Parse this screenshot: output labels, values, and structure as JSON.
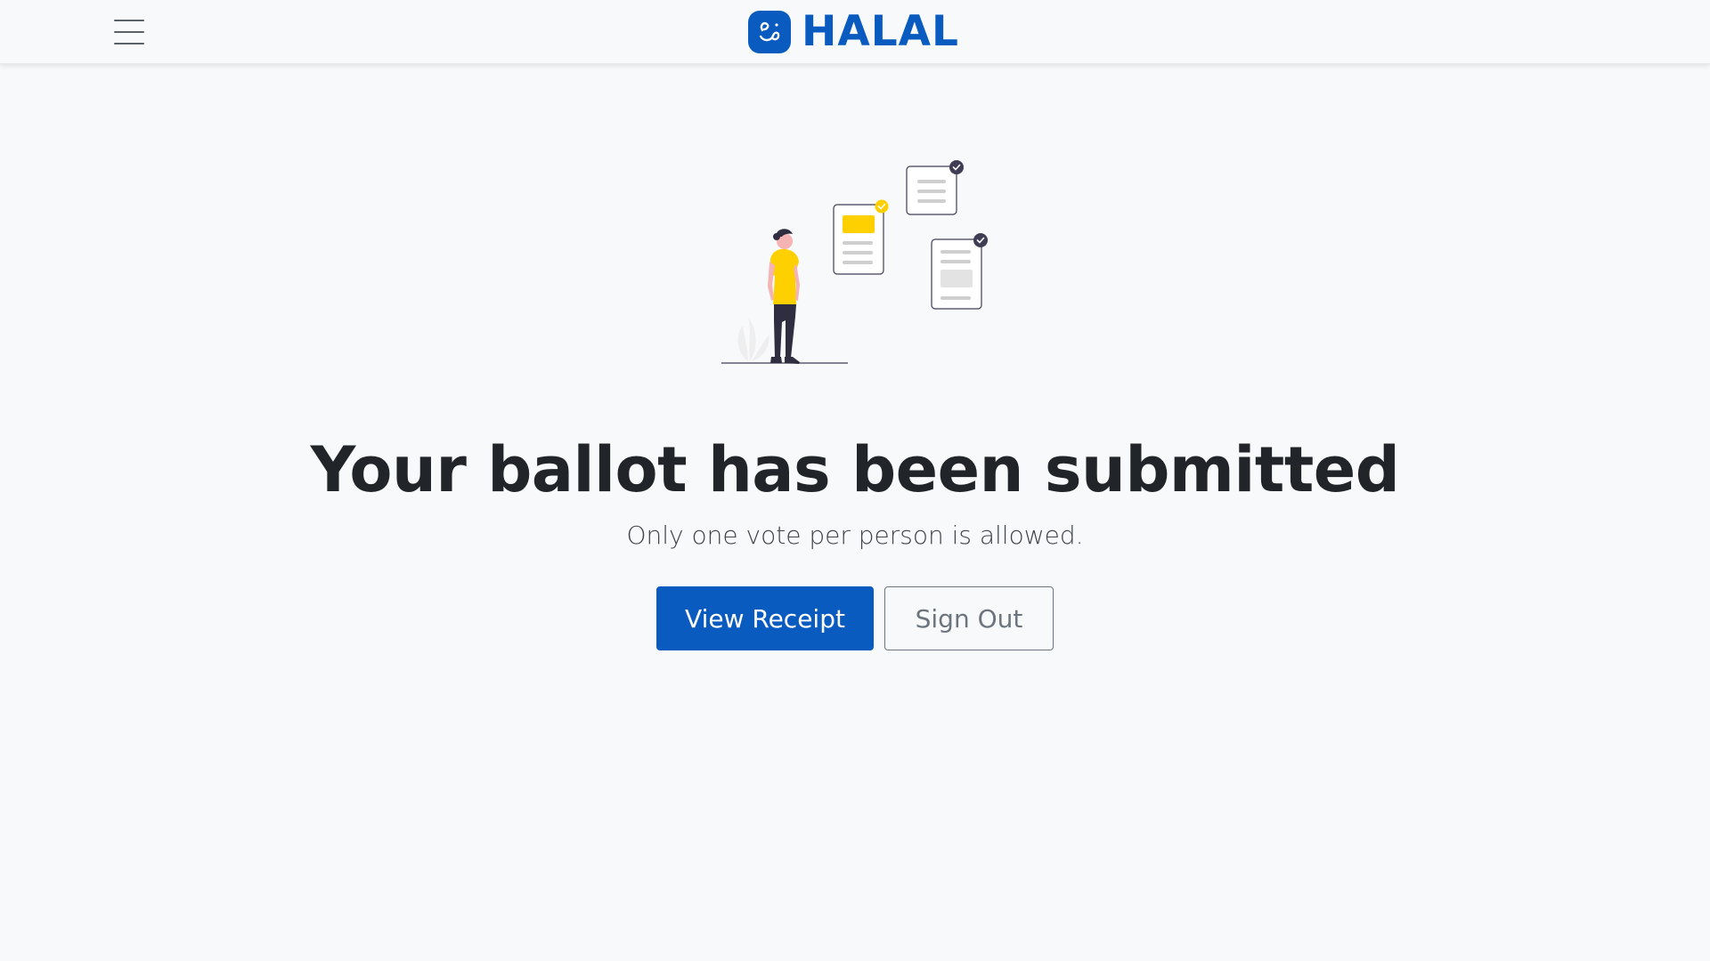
{
  "navbar": {
    "menu_icon": "hamburger-menu-icon",
    "brand_icon": "halal-logo-icon",
    "brand_name": "HALAL"
  },
  "hero": {
    "illustration": "voter-with-ballots-illustration",
    "title": "Your ballot has been submitted",
    "subtitle": "Only one vote per person is allowed."
  },
  "actions": {
    "view_receipt_label": "View Receipt",
    "sign_out_label": "Sign Out"
  },
  "colors": {
    "brand": "#0a5bc0",
    "accent_yellow": "#ffd000",
    "background": "#f8f9fb",
    "text_dark": "#212529",
    "muted": "#6c757d"
  }
}
